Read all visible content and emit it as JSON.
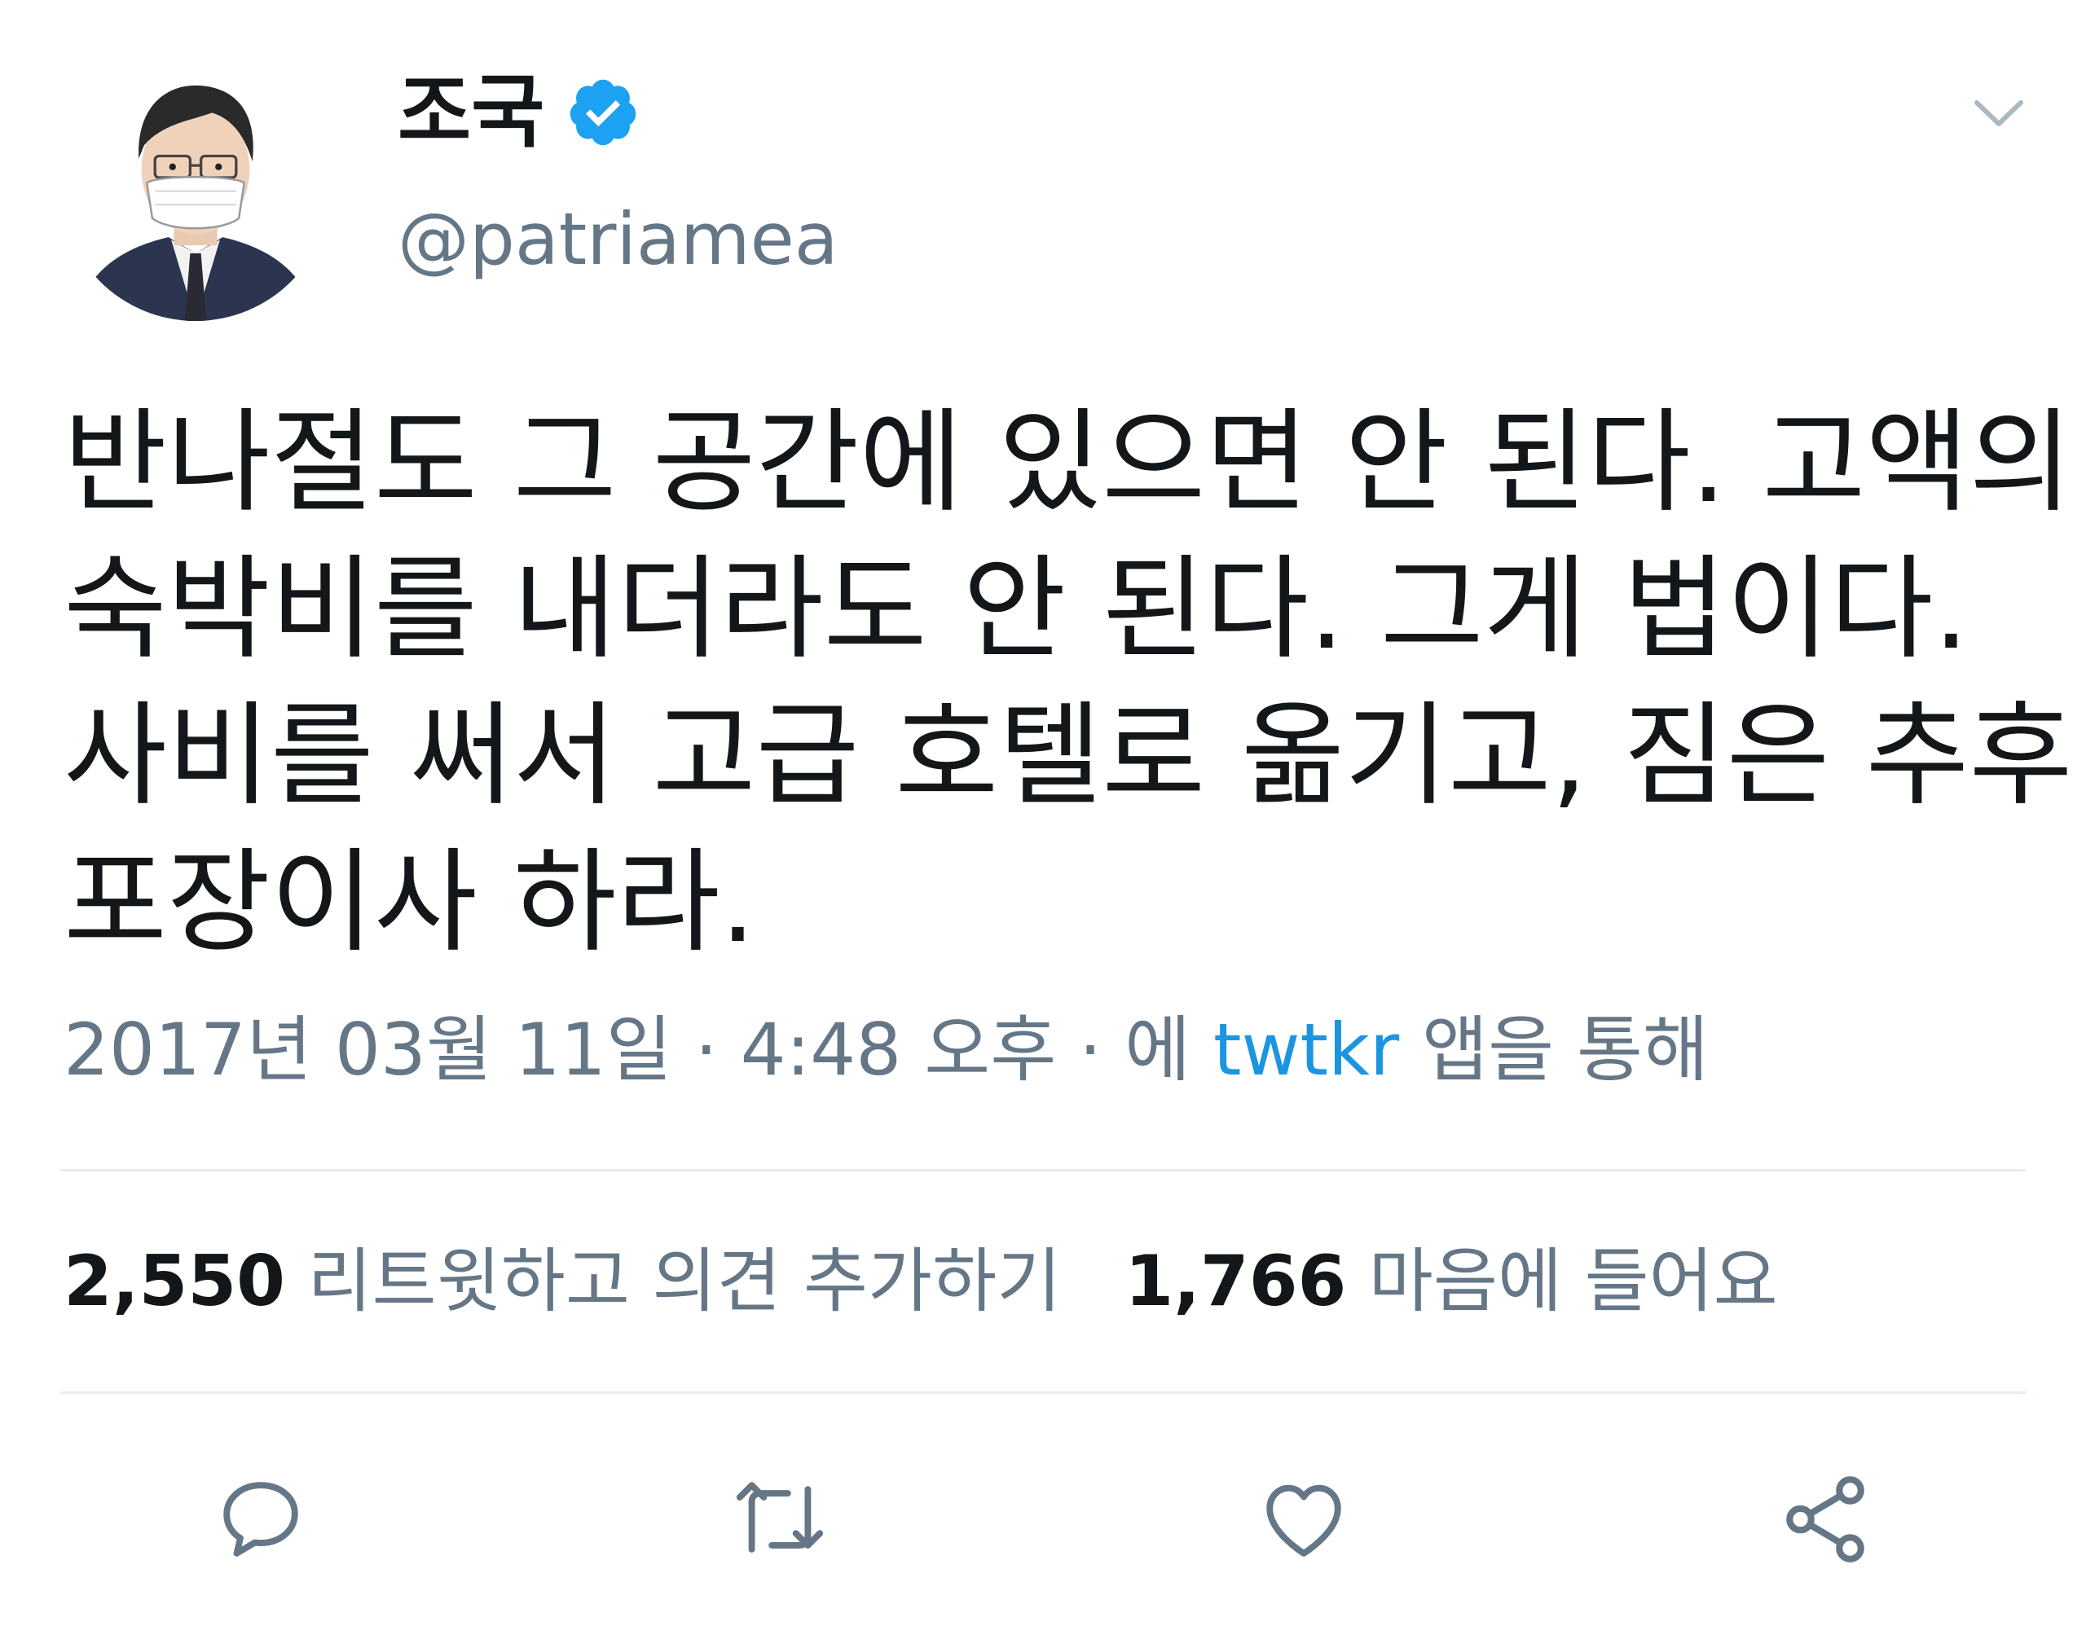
{
  "author": {
    "display_name": "조국",
    "handle": "@patriamea",
    "verified": true,
    "avatar_icon": "avatar-illustration"
  },
  "tweet": {
    "lines": [
      "반나절도 그 공간에 있으면 안 된다. 고액의",
      "숙박비를 내더라도 안 된다. 그게 법이다.",
      "사비를 써서 고급 호텔로 옮기고, 짐은 추후",
      "포장이사 하라."
    ]
  },
  "meta": {
    "date": "2017년 03월 11일",
    "sep1": " · ",
    "time": "4:48 오후",
    "sep2": " · ",
    "via_prefix": "에 ",
    "source": "twtkr",
    "via_suffix": " 앱을 통해"
  },
  "stats": {
    "retweets_count": "2,550",
    "retweets_label": " 리트윗하고 의견 추가하기",
    "likes_count": "1,766",
    "likes_label": " 마음에 들어요"
  },
  "actions": {
    "reply_icon": "reply-icon",
    "retweet_icon": "retweet-icon",
    "like_icon": "heart-icon",
    "share_icon": "share-icon"
  },
  "colors": {
    "text_primary": "#14171a",
    "text_secondary": "#657786",
    "link": "#1b95e0",
    "verified": "#1da1f2",
    "divider": "#e6ecf0",
    "icon": "#657786"
  }
}
